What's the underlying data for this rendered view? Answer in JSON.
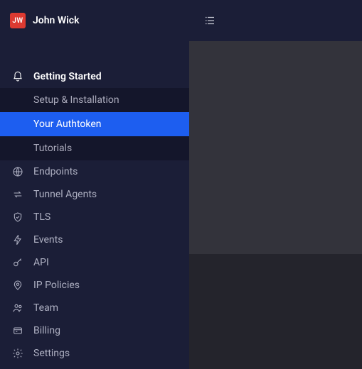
{
  "user": {
    "initials": "JW",
    "name": "John Wick"
  },
  "nav": {
    "getting_started": {
      "label": "Getting Started",
      "children": {
        "setup": "Setup & Installation",
        "authtoken": "Your Authtoken",
        "tutorials": "Tutorials"
      }
    },
    "endpoints": "Endpoints",
    "tunnel_agents": "Tunnel Agents",
    "tls": "TLS",
    "events": "Events",
    "api": "API",
    "ip_policies": "IP Policies",
    "team": "Team",
    "billing": "Billing",
    "settings": "Settings"
  },
  "colors": {
    "sidebar_bg": "#1b1e37",
    "active_bg": "#1d5ef0",
    "avatar_bg": "#dd3a31",
    "arrow": "#ff0000"
  }
}
